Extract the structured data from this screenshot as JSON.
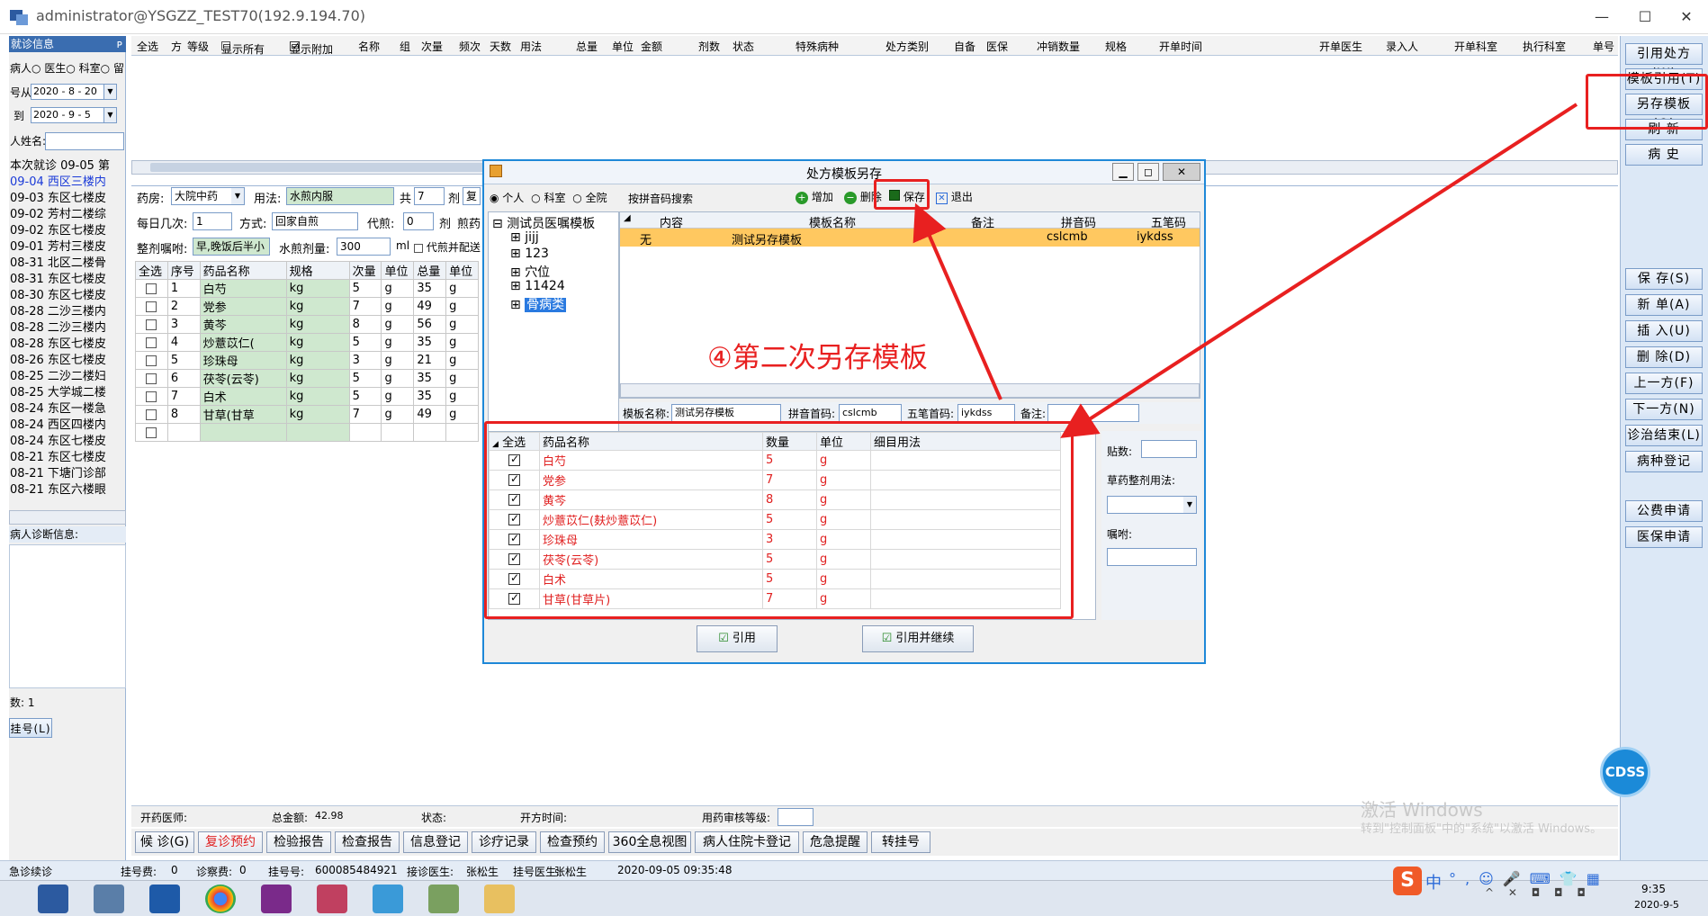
{
  "window": {
    "title": "administrator@YSGZZ_TEST70(192.9.194.70)"
  },
  "left_panel": {
    "header": "就诊信息",
    "radio_options": [
      "病人",
      "医生",
      "科室",
      "留"
    ],
    "date_from_label": "号从",
    "date_from": "2020 - 8 - 20",
    "date_to_label": "到",
    "date_to": "2020 - 9 - 5",
    "name_label": "人姓名:",
    "visits": [
      "本次就诊 09-05 第",
      "09-04 西区三楼内",
      "09-03 东区七楼皮",
      "09-02 芳村二楼综",
      "09-02 东区七楼皮",
      "09-01 芳村三楼皮",
      "08-31 北区二楼骨",
      "08-31 东区七楼皮",
      "08-30 东区七楼皮",
      "08-28 二沙三楼内",
      "08-28 二沙三楼内",
      "08-28 东区七楼皮",
      "08-26 东区七楼皮",
      "08-25 二沙二楼妇",
      "08-25 大学城二楼",
      "08-24 东区一楼急",
      "08-24 西区四楼内",
      "08-24 东区七楼皮",
      "08-21 东区七楼皮",
      "08-21 下塘门诊部",
      "08-21 东区六楼眼"
    ],
    "diag_label": "病人诊断信息:",
    "count_label": "数: 1",
    "reg_button": "挂号(L)"
  },
  "top_grid": {
    "headers": [
      "全选",
      "方",
      "等级",
      "显示所有",
      "显示附加",
      "名称",
      "组",
      "次量",
      "频次",
      "天数",
      "用法",
      "总量",
      "单位",
      "金额",
      "剂数",
      "状态",
      "特殊病种",
      "处方类别",
      "自备",
      "医保",
      "冲销数量",
      "规格",
      "开单时间",
      "开单医生",
      "录入人",
      "开单科室",
      "执行科室",
      "单号"
    ]
  },
  "rx_form": {
    "pharmacy_label": "药房:",
    "pharmacy": "大院中药",
    "usage_label": "用法:",
    "usage": "水煎内服",
    "total_label": "共",
    "total": "7",
    "dose_unit": "剂",
    "daily_label": "每日几次:",
    "daily": "1",
    "method_label": "方式:",
    "method": "回家自煎",
    "decoct_label": "代煎:",
    "decoct": "0",
    "decoct_unit": "剂",
    "pre_decoct": "煎药",
    "advice_label": "整剂嘱咐:",
    "advice": "早,晚饭后半小",
    "water_label": "水煎剂量:",
    "water": "300",
    "water_unit": "ml",
    "decoct_mix": "代煎并配送",
    "dup_button": "复"
  },
  "drug_table": {
    "headers": [
      "全选",
      "序号",
      "药品名称",
      "规格",
      "次量",
      "单位",
      "总量",
      "单位"
    ],
    "rows": [
      {
        "no": "1",
        "name": "白芍",
        "spec": "kg",
        "qty": "5",
        "unit": "g",
        "total": "35",
        "tunit": "g"
      },
      {
        "no": "2",
        "name": "党参",
        "spec": "kg",
        "qty": "7",
        "unit": "g",
        "total": "49",
        "tunit": "g"
      },
      {
        "no": "3",
        "name": "黄芩",
        "spec": "kg",
        "qty": "8",
        "unit": "g",
        "total": "56",
        "tunit": "g"
      },
      {
        "no": "4",
        "name": "炒薏苡仁(",
        "spec": "kg",
        "qty": "5",
        "unit": "g",
        "total": "35",
        "tunit": "g"
      },
      {
        "no": "5",
        "name": "珍珠母",
        "spec": "kg",
        "qty": "3",
        "unit": "g",
        "total": "21",
        "tunit": "g"
      },
      {
        "no": "6",
        "name": "茯苓(云苓)",
        "spec": "kg",
        "qty": "5",
        "unit": "g",
        "total": "35",
        "tunit": "g"
      },
      {
        "no": "7",
        "name": "白术",
        "spec": "kg",
        "qty": "5",
        "unit": "g",
        "total": "35",
        "tunit": "g"
      },
      {
        "no": "8",
        "name": "甘草(甘草",
        "spec": "kg",
        "qty": "7",
        "unit": "g",
        "total": "49",
        "tunit": "g"
      }
    ]
  },
  "right_panel": {
    "buttons_top": [
      "引用处方(W)",
      "模板引用(T)",
      "另存模板(Q)",
      "刷 新",
      "病 史"
    ],
    "buttons_mid": [
      "保 存(S)",
      "新 单(A)",
      "插 入(U)",
      "删 除(D)",
      "上一方(F)",
      "下一方(N)",
      "诊治结束(L)",
      "病种登记"
    ],
    "buttons_bottom": [
      "公费申请",
      "医保申请"
    ]
  },
  "status_bar": {
    "doctor_label": "开药医师:",
    "amount_label": "总金额:",
    "amount": "42.98",
    "state_label": "状态:",
    "time_label": "开方时间:",
    "audit_label": "用药审核等级:"
  },
  "bottom_buttons": [
    "候 诊(G)",
    "复诊预约",
    "检验报告",
    "检查报告",
    "信息登记",
    "诊疗记录",
    "检查预约",
    "360全息视图",
    "病人住院卡登记",
    "危急提醒",
    "转挂号"
  ],
  "info_bar": {
    "mode": "急诊续诊",
    "reg_fee_label": "挂号费:",
    "reg_fee": "0",
    "clinic_fee_label": "诊察费:",
    "clinic_fee": "0",
    "reg_no_label": "挂号号:",
    "reg_no": "600085484921",
    "receive_doc_label": "接诊医生:",
    "receive_doc": "张松生",
    "reg_doc_label": "挂号医生:",
    "reg_doc": "张松生",
    "datetime": "2020-09-05 09:35:48"
  },
  "dialog": {
    "title": "处方模板另存",
    "scope_options": [
      "个人",
      "科室",
      "全院"
    ],
    "search_label": "按拼音码搜索",
    "toolbar": {
      "add": "增加",
      "delete": "删除",
      "save": "保存",
      "exit": "退出"
    },
    "tree": [
      "测试员医嘱模板",
      "jijj",
      "123",
      "穴位",
      "11424",
      "骨病类"
    ],
    "template_headers": [
      "内容",
      "模板名称",
      "备注",
      "拼音码",
      "五笔码"
    ],
    "template_row": {
      "content": "无",
      "name": "测试另存模板",
      "remark": "",
      "pinyin": "cslcmb",
      "wubi": "iykdss"
    },
    "form": {
      "name_label": "模板名称:",
      "name": "测试另存模板",
      "pinyin_label": "拼音首码:",
      "pinyin": "cslcmb",
      "wubi_label": "五笔首码:",
      "wubi": "iykdss",
      "remark_label": "备注:"
    },
    "drug_headers": [
      "全选",
      "药品名称",
      "数量",
      "单位",
      "细目用法"
    ],
    "drugs": [
      {
        "name": "白芍",
        "qty": "5",
        "unit": "g"
      },
      {
        "name": "党参",
        "qty": "7",
        "unit": "g"
      },
      {
        "name": "黄芩",
        "qty": "8",
        "unit": "g"
      },
      {
        "name": "炒薏苡仁(麸炒薏苡仁)",
        "qty": "5",
        "unit": "g"
      },
      {
        "name": "珍珠母",
        "qty": "3",
        "unit": "g"
      },
      {
        "name": "茯苓(云苓)",
        "qty": "5",
        "unit": "g"
      },
      {
        "name": "白术",
        "qty": "5",
        "unit": "g"
      },
      {
        "name": "甘草(甘草片)",
        "qty": "7",
        "unit": "g"
      }
    ],
    "side": {
      "dose_label": "贴数:",
      "usage_label": "草药整剂用法:",
      "advice_label": "嘱咐:"
    },
    "cite_button": "引用",
    "cite_continue_button": "引用并继续"
  },
  "annotation": "④第二次另存模板",
  "watermark": {
    "line1": "激活 Windows",
    "line2": "转到\"控制面板\"中的\"系统\"以激活 Windows。"
  },
  "cdss": "CDSS",
  "taskbar": {
    "time": "9:35",
    "date": "2020-9-5",
    "ime": "中"
  },
  "colors": {
    "accent": "#1e88d8",
    "annotation": "#e82020",
    "highlight_row": "#ffc860",
    "green_cell": "#cfe8cf"
  }
}
